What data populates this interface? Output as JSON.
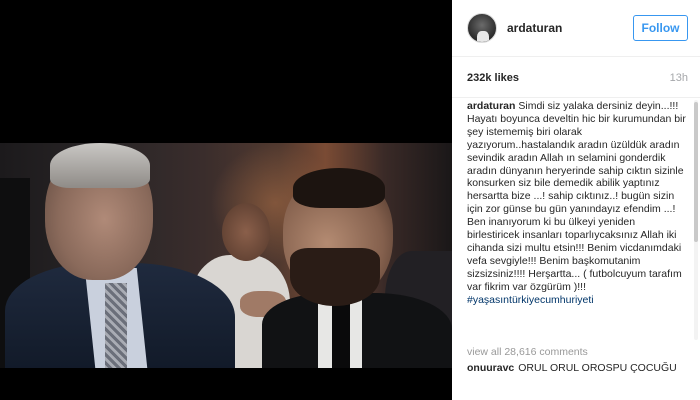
{
  "post": {
    "username": "ardaturan",
    "follow_label": "Follow",
    "likes": "232k likes",
    "time_ago": "13h",
    "caption": {
      "username": "ardaturan",
      "text": "Simdi siz yalaka dersiniz deyin...!!! Hayatı boyunca develtin hic bir kurumundan bir şey istememiş biri olarak yazıyorum..hastalandık aradın üzüldük aradın sevindik aradın Allah ın selamini gonderdik aradın dünyanın heryerinde sahip cıktın sizinle konsurken siz bile demedik abilik yaptınız hersartta bize ...! sahip cıktınız..! bugün sizin için zor günse bu gün yanındayız efendim ...! Ben inanıyorum ki bu ülkeyi yeniden birlestiricek insanları toparlıycaksınız Allah iki cihanda sizi multu etsin!!! Benim vicdanımdaki vefa sevgiyle!!! Benim başkomutanim sizsizsiniz!!!! Herşartta... ( futbolcuyum tarafım var fikrim var özgürüm )!!! ",
      "hashtag": "#yaşasıntürkiyecumhuriyeti"
    },
    "view_all_comments": "view all 28,616 comments",
    "comments": [
      {
        "username": "onuuravc",
        "text": "ORUL ORUL OROSPU ÇOCUĞU"
      }
    ]
  },
  "colors": {
    "accent": "#3897f0",
    "hashtag": "#003569",
    "muted": "#999999",
    "media_background": "#000000"
  }
}
